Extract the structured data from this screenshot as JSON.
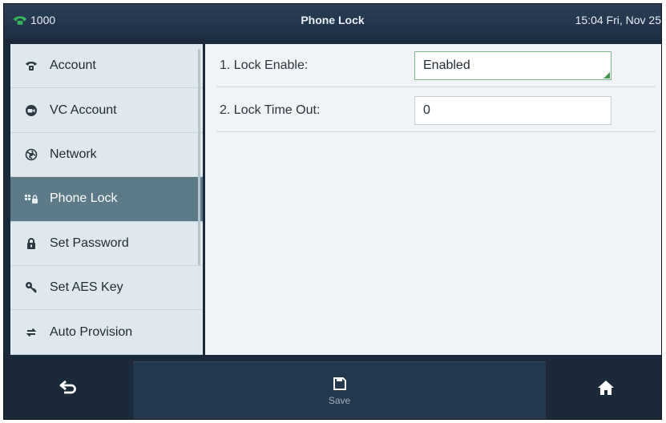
{
  "status_bar": {
    "line": "1000",
    "title": "Phone Lock",
    "datetime": "15:04 Fri, Nov 25",
    "line_icon": "phone-handset-icon"
  },
  "sidebar": {
    "items": [
      {
        "label": "Account",
        "icon": "phone-icon",
        "active": false
      },
      {
        "label": "VC Account",
        "icon": "vc-icon",
        "active": false
      },
      {
        "label": "Network",
        "icon": "network-icon",
        "active": false
      },
      {
        "label": "Phone Lock",
        "icon": "keypad-lock-icon",
        "active": true
      },
      {
        "label": "Set Password",
        "icon": "padlock-icon",
        "active": false
      },
      {
        "label": "Set AES Key",
        "icon": "key-icon",
        "active": false
      },
      {
        "label": "Auto Provision",
        "icon": "sync-icon",
        "active": false
      }
    ]
  },
  "settings": [
    {
      "label": "1. Lock Enable:",
      "value": "Enabled",
      "type": "dropdown"
    },
    {
      "label": "2. Lock Time Out:",
      "value": "0",
      "type": "text"
    }
  ],
  "bottom_bar": {
    "back_icon": "back-arrow-icon",
    "save_label": "Save",
    "save_icon": "floppy-disk-icon",
    "home_icon": "home-icon"
  },
  "colors": {
    "status_bar": "#22354b",
    "active_item": "#5d7a89",
    "accent_green": "#3f9a4e",
    "sidebar_bg": "#dfe8ec",
    "content_bg": "#f1f4f6"
  }
}
